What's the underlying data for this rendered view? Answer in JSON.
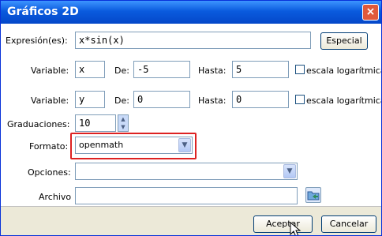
{
  "window": {
    "title": "Gráficos 2D",
    "close_glyph": "×"
  },
  "expression": {
    "label": "Expresión(es):",
    "value": "x*sin(x)",
    "special_button": "Especial"
  },
  "var1": {
    "label": "Variable:",
    "name": "x",
    "from_label": "De:",
    "from": "-5",
    "to_label": "Hasta:",
    "to": "5",
    "log_label": "escala logarítmica"
  },
  "var2": {
    "label": "Variable:",
    "name": "y",
    "from_label": "De:",
    "from": "0",
    "to_label": "Hasta:",
    "to": "0",
    "log_label": "escala logarítmica"
  },
  "grid": {
    "label": "Graduaciones:",
    "value": "10"
  },
  "format": {
    "label": "Formato:",
    "value": "openmath"
  },
  "options": {
    "label": "Opciones:",
    "value": ""
  },
  "file": {
    "label": "Archivo",
    "value": ""
  },
  "buttons": {
    "accept": "Aceptar",
    "cancel": "Cancelar"
  },
  "colors": {
    "highlight": "#dd2222",
    "title_bar": "#0a5bde"
  }
}
